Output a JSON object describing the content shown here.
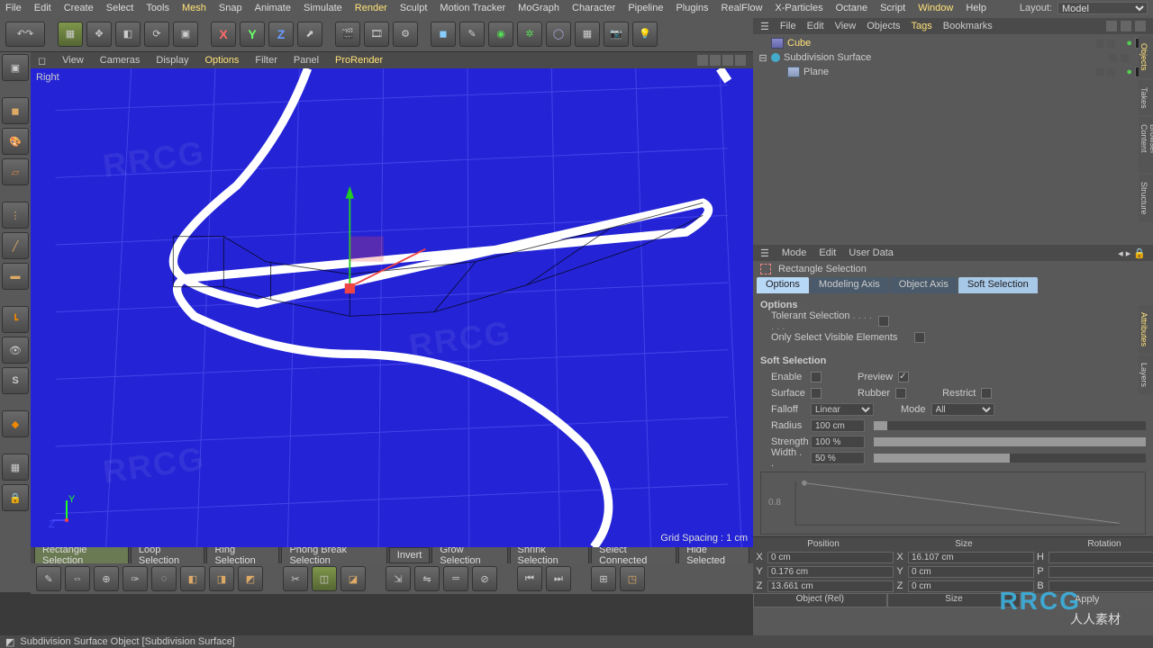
{
  "menubar": {
    "items": [
      "File",
      "Edit",
      "Create",
      "Select",
      "Tools",
      "Mesh",
      "Snap",
      "Animate",
      "Simulate",
      "Render",
      "Sculpt",
      "Motion Tracker",
      "MoGraph",
      "Character",
      "Pipeline",
      "Plugins",
      "RealFlow",
      "X-Particles",
      "Octane",
      "Script",
      "Window",
      "Help"
    ],
    "highlight": [
      "Mesh",
      "Render",
      "Window"
    ],
    "layout_label": "Layout:",
    "layout_value": "Model"
  },
  "viewport_menu": {
    "items": [
      "View",
      "Cameras",
      "Display",
      "Options",
      "Filter",
      "Panel",
      "ProRender"
    ],
    "highlight": [
      "Options",
      "ProRender"
    ]
  },
  "viewport": {
    "name": "Right",
    "grid_spacing": "Grid Spacing : 1 cm",
    "axis_y": "Y",
    "axis_z": "Z"
  },
  "selection_buttons": [
    "Rectangle Selection",
    "Loop Selection",
    "Ring Selection",
    "Phong Break Selection",
    "Invert",
    "Grow Selection",
    "Shrink Selection",
    "Select Connected",
    "Hide Selected"
  ],
  "selection_active": 0,
  "objects_panel": {
    "menu": [
      "File",
      "Edit",
      "View",
      "Objects",
      "Tags",
      "Bookmarks"
    ],
    "menu_hl": [
      "Tags"
    ],
    "rows": [
      {
        "name": "Cube",
        "sel": true,
        "icon": "cube",
        "indent": 0,
        "expand": ""
      },
      {
        "name": "Subdivision Surface",
        "sel": false,
        "icon": "sds",
        "indent": 0,
        "expand": "⊟"
      },
      {
        "name": "Plane",
        "sel": false,
        "icon": "plane",
        "indent": 1,
        "expand": ""
      }
    ]
  },
  "attr_menu": [
    "Mode",
    "Edit",
    "User Data"
  ],
  "attr_title": "Rectangle Selection",
  "attr_tabs": [
    "Options",
    "Modeling Axis",
    "Object Axis",
    "Soft Selection"
  ],
  "attr_tab_active": 0,
  "attr_tab_sel": 3,
  "options_section": {
    "title": "Options",
    "tolerant": "Tolerant Selection",
    "only_visible": "Only Select Visible Elements"
  },
  "soft_section": {
    "title": "Soft Selection",
    "enable": "Enable",
    "preview": "Preview",
    "surface": "Surface",
    "rubber": "Rubber",
    "restrict": "Restrict",
    "falloff": "Falloff",
    "falloff_val": "Linear",
    "mode": "Mode",
    "mode_val": "All",
    "radius": "Radius",
    "radius_val": "100 cm",
    "strength": "Strength",
    "strength_val": "100 %",
    "width": "Width . .",
    "width_val": "50 %",
    "graph_label": "0.8"
  },
  "coords": {
    "headers": [
      "Position",
      "Size",
      "Rotation"
    ],
    "x": {
      "p": "0 cm",
      "s": "16.107 cm",
      "r": ""
    },
    "y": {
      "p": "0.176 cm",
      "s": "0 cm",
      "r": ""
    },
    "z": {
      "p": "13.661 cm",
      "s": "0 cm",
      "r": ""
    },
    "foot_left": "Object (Rel)",
    "foot_mid": "Size",
    "foot_right": "Apply"
  },
  "side_tabs": [
    "Objects",
    "Takes",
    "Content Browser",
    "Structure",
    "Attributes",
    "Layers"
  ],
  "side_tabs_hl": [
    "Objects",
    "Attributes"
  ],
  "status": "Subdivision Surface Object [Subdivision Surface]",
  "watermarks": {
    "rrcg": "RRCG",
    "cn": "人人素材"
  }
}
